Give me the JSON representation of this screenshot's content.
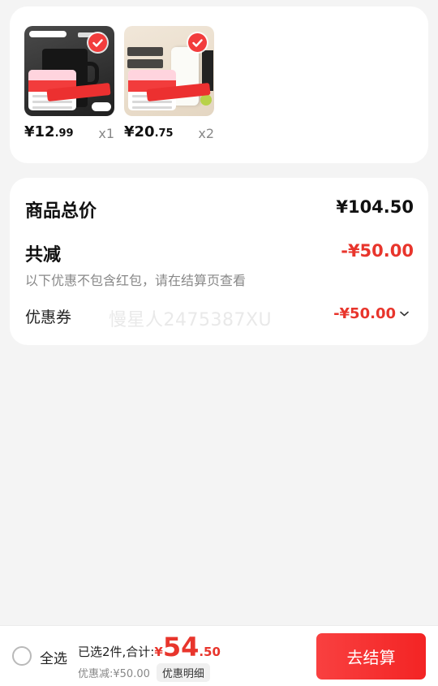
{
  "items": [
    {
      "image": "black-mug-product-photo",
      "price_int": "¥12",
      "price_dec": ".99",
      "qty": "x1",
      "selected": true,
      "bg_colors": [
        "#4a4a4a",
        "#1f1f1f"
      ]
    },
    {
      "image": "white-cup-product-photo",
      "price_int": "¥20",
      "price_dec": ".75",
      "qty": "x2",
      "selected": true,
      "bg_colors": [
        "#f1e7d9",
        "#e4d6c2"
      ]
    }
  ],
  "summary": {
    "total_label": "商品总价",
    "total_value": "¥104.50",
    "reduce_label": "共减",
    "reduce_value": "-¥50.00",
    "note": "以下优惠不包含红包，请在结算页查看",
    "coupon_label": "优惠券",
    "watermark": "慢星人2475387XU",
    "coupon_value": "-¥50.00",
    "coupon_icon": "chevron-down-icon"
  },
  "bottom": {
    "select_all": "全选",
    "selected_summary": "已选2件,合计:",
    "yen": "¥",
    "total_int": "54",
    "total_dec": ".50",
    "discount": "优惠减:¥50.00",
    "detail_button": "优惠明细",
    "checkout_button": "去结算"
  },
  "colors": {
    "accent": "#f23c3c",
    "price_red": "#e8352c",
    "background": "#f4f4f4"
  }
}
